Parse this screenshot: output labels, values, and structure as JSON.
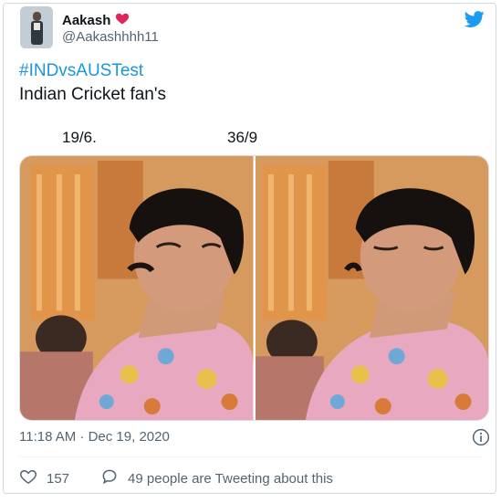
{
  "user": {
    "display_name": "Aakash",
    "handle": "@Aakashhhh11",
    "name_emoji": "heart-icon"
  },
  "tweet": {
    "hashtag": "#INDvsAUSTest",
    "text": "Indian Cricket fan's",
    "caption_left": "19/6.",
    "caption_right": "36/9",
    "timestamp": "11:18 AM · Dec 19, 2020"
  },
  "actions": {
    "like_count": "157",
    "conversation_label": "49 people are Tweeting about this"
  },
  "colors": {
    "hashtag": "#1b95e0",
    "twitter_blue": "#1d9bf0",
    "heart": "#e0245e",
    "secondary_text": "#536471"
  },
  "icons": [
    "heart-icon",
    "twitter-bird-icon",
    "info-icon",
    "like-icon",
    "conversation-icon"
  ]
}
